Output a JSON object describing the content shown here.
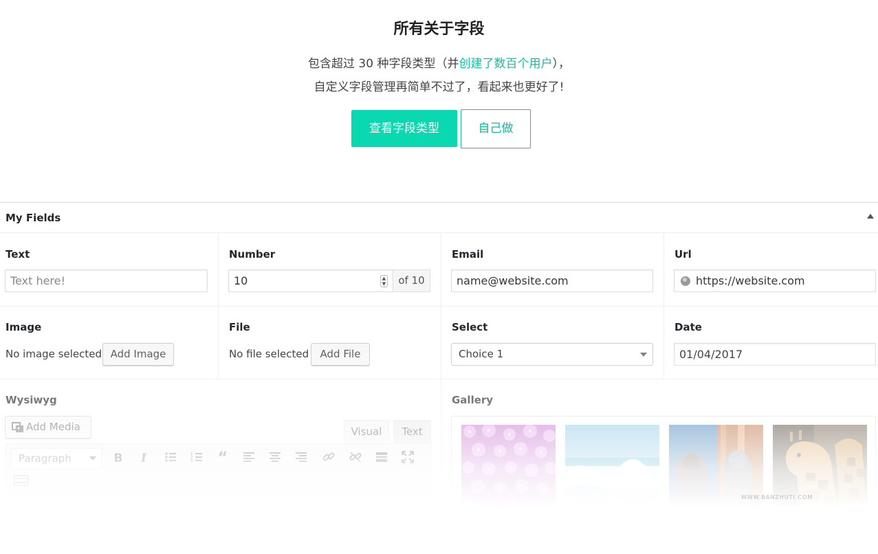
{
  "hero": {
    "title": "所有关于字段",
    "line1_before": "包含超过 30 种字段类型（并",
    "line1_link": "创建了数百个用户",
    "line1_after": "），",
    "line2": "自定义字段管理再简单不过了，看起来也更好了!",
    "primary_button": "查看字段类型",
    "outline_button": "自己做",
    "accent_color": "#0ad8b0"
  },
  "metabox": {
    "title": "My Fields",
    "fields": {
      "text": {
        "label": "Text",
        "placeholder": "Text here!"
      },
      "number": {
        "label": "Number",
        "value": "10",
        "append": "of 10"
      },
      "email": {
        "label": "Email",
        "value": "name@website.com"
      },
      "url": {
        "label": "Url",
        "value": "https://website.com",
        "icon": "globe-icon"
      },
      "image": {
        "label": "Image",
        "status": "No image selected",
        "button": "Add Image"
      },
      "file": {
        "label": "File",
        "status": "No file selected",
        "button": "Add File"
      },
      "select": {
        "label": "Select",
        "value": "Choice 1"
      },
      "date": {
        "label": "Date",
        "value": "01/04/2017"
      },
      "wysiwyg": {
        "label": "Wysiwyg",
        "add_media": "Add Media",
        "tab_visual": "Visual",
        "tab_text": "Text",
        "format": "Paragraph",
        "toolbar_icons": [
          "bold-icon",
          "italic-icon",
          "bullet-list-icon",
          "numbered-list-icon",
          "blockquote-icon",
          "align-left-icon",
          "align-center-icon",
          "align-right-icon",
          "link-icon",
          "unlink-icon",
          "read-more-icon",
          "fullscreen-icon",
          "keyboard-icon"
        ]
      },
      "gallery": {
        "label": "Gallery",
        "images": [
          "flowers",
          "ocean-wave",
          "statues",
          "giraffe"
        ]
      }
    }
  },
  "watermark": "WWW.BANZHUTI.COM"
}
